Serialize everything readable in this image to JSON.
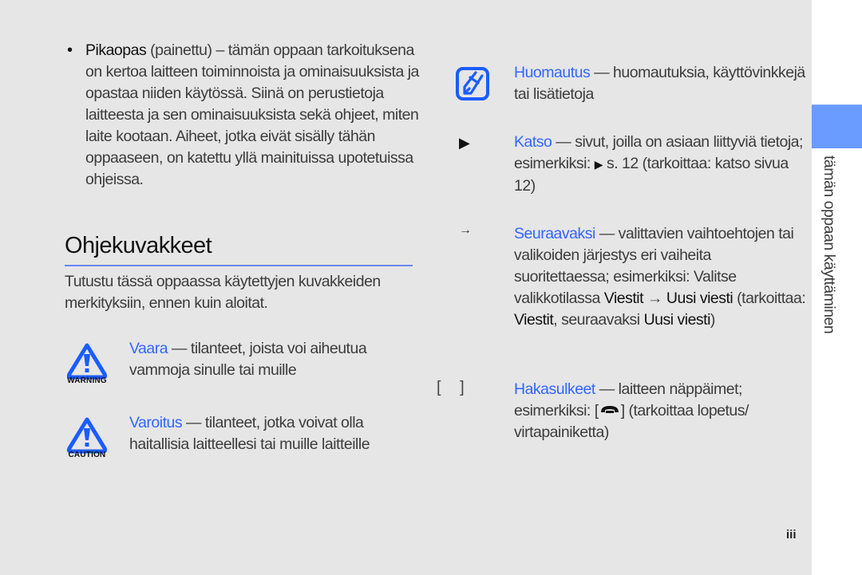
{
  "side_tab": {
    "label": "tämän oppaan käyttäminen",
    "color": "#6a9cff"
  },
  "bullet": {
    "title": "Pikaopas",
    "qualifier": "(painettu)",
    "dash": " – ",
    "text_first": "tämän oppaan",
    "text_rest": "tarkoituksena on kertoa laitteen toiminnoista ja ominaisuuksista ja opastaa niiden käytössä. Siinä on perustietoja laitteesta ja sen ominaisuuksista sekä ohjeet, miten laite kootaan. Aiheet, jotka eivät sisälly tähän oppaaseen, on katettu yllä mainituissa upotetuissa ohjeissa."
  },
  "section": {
    "heading": "Ohjekuvakkeet",
    "intro": "Tutustu tässä oppaassa käytettyjen kuvakkeiden merkityksiin, ennen kuin aloitat."
  },
  "icons_left": [
    {
      "icon": "warning-icon",
      "badge": "WARNING",
      "term": "Vaara",
      "desc": " — tilanteet, joista voi aiheutua vammoja sinulle tai muille"
    },
    {
      "icon": "caution-icon",
      "badge": "CAUTION",
      "term": "Varoitus",
      "desc": " — tilanteet, jotka voivat olla haitallisia laitteellesi tai muille laitteille"
    }
  ],
  "icons_right": {
    "note": {
      "icon": "note-pencil-icon",
      "term": "Huomautus",
      "desc": " — huomautuksia, käyttövinkkejä tai lisätietoja"
    },
    "refer": {
      "icon": "triangle-right-icon",
      "glyph": "▶",
      "term": "Katso",
      "desc_before": " — sivut, joilla on asiaan liittyviä tietoja; esimerkiksi: ",
      "inline_glyph": "▶",
      "desc_after": " s. 12 (tarkoittaa: katso sivua 12)"
    },
    "next": {
      "icon": "arrow-right-icon",
      "glyph": "→",
      "term": "Seuraavaksi",
      "desc_1": " — valittavien vaihtoehtojen tai valikoiden järjestys eri vaiheita suoritettaessa; esimerkiksi: Valitse valikkotilassa ",
      "menu_1": "Viestit",
      "arrow": " → ",
      "menu_2": "Uusi viesti",
      "desc_2": " (tarkoittaa: ",
      "menu_1b": "Viestit",
      "desc_3": ", seuraavaksi ",
      "menu_2b": "Uusi viesti",
      "desc_4": ")"
    },
    "brackets": {
      "icon": "brackets-icon",
      "glyph": "[ ]",
      "term": "Hakasulkeet",
      "desc_1": " — laitteen näppäimet; esimerkiksi: [",
      "key_icon": "end-call-key-icon",
      "desc_2": "] (tarkoittaa lopetus/ virtapainiketta)"
    }
  },
  "page_number": "iii",
  "colors": {
    "accent": "#3366ff",
    "icon_blue": "#1a5cff",
    "page_bg": "#e6e6e6",
    "rule": "#6a86ee"
  }
}
